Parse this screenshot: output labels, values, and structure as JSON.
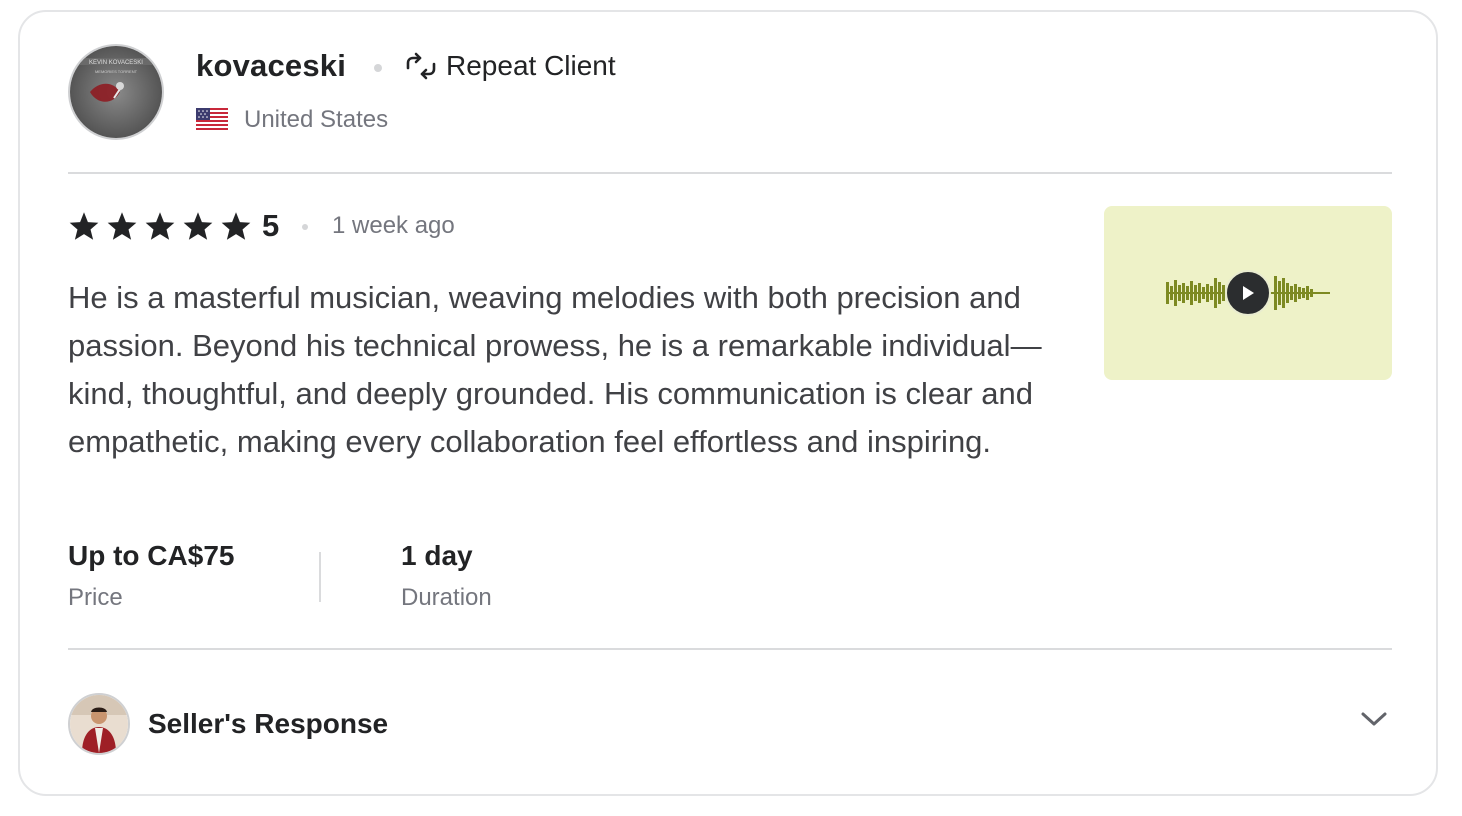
{
  "reviewer": {
    "username": "kovaceski",
    "badge_label": "Repeat Client",
    "badge_icon": "repeat-icon",
    "country": "United States",
    "country_flag_icon": "us-flag-icon",
    "avatar_text_top": "KEVIN KOVACESKI",
    "avatar_text_sub": "MEMORIES TORRENT"
  },
  "review": {
    "stars": 5,
    "rating": "5",
    "time_ago": "1 week ago",
    "text": "He is a masterful musician, weaving melodies with both precision and passion. Beyond his technical prowess, he is a remarkable individual—kind, thoughtful, and deeply grounded. His communication is clear and empathetic, making every collaboration feel effortless and inspiring."
  },
  "audio_preview": {
    "icon": "play-icon",
    "background_color": "#eef2c8",
    "waveform_color": "#7d8a22"
  },
  "order_meta": {
    "price_value": "Up to CA$75",
    "price_label": "Price",
    "duration_value": "1 day",
    "duration_label": "Duration"
  },
  "seller_response": {
    "label": "Seller's Response",
    "toggle_icon": "chevron-down-icon"
  }
}
